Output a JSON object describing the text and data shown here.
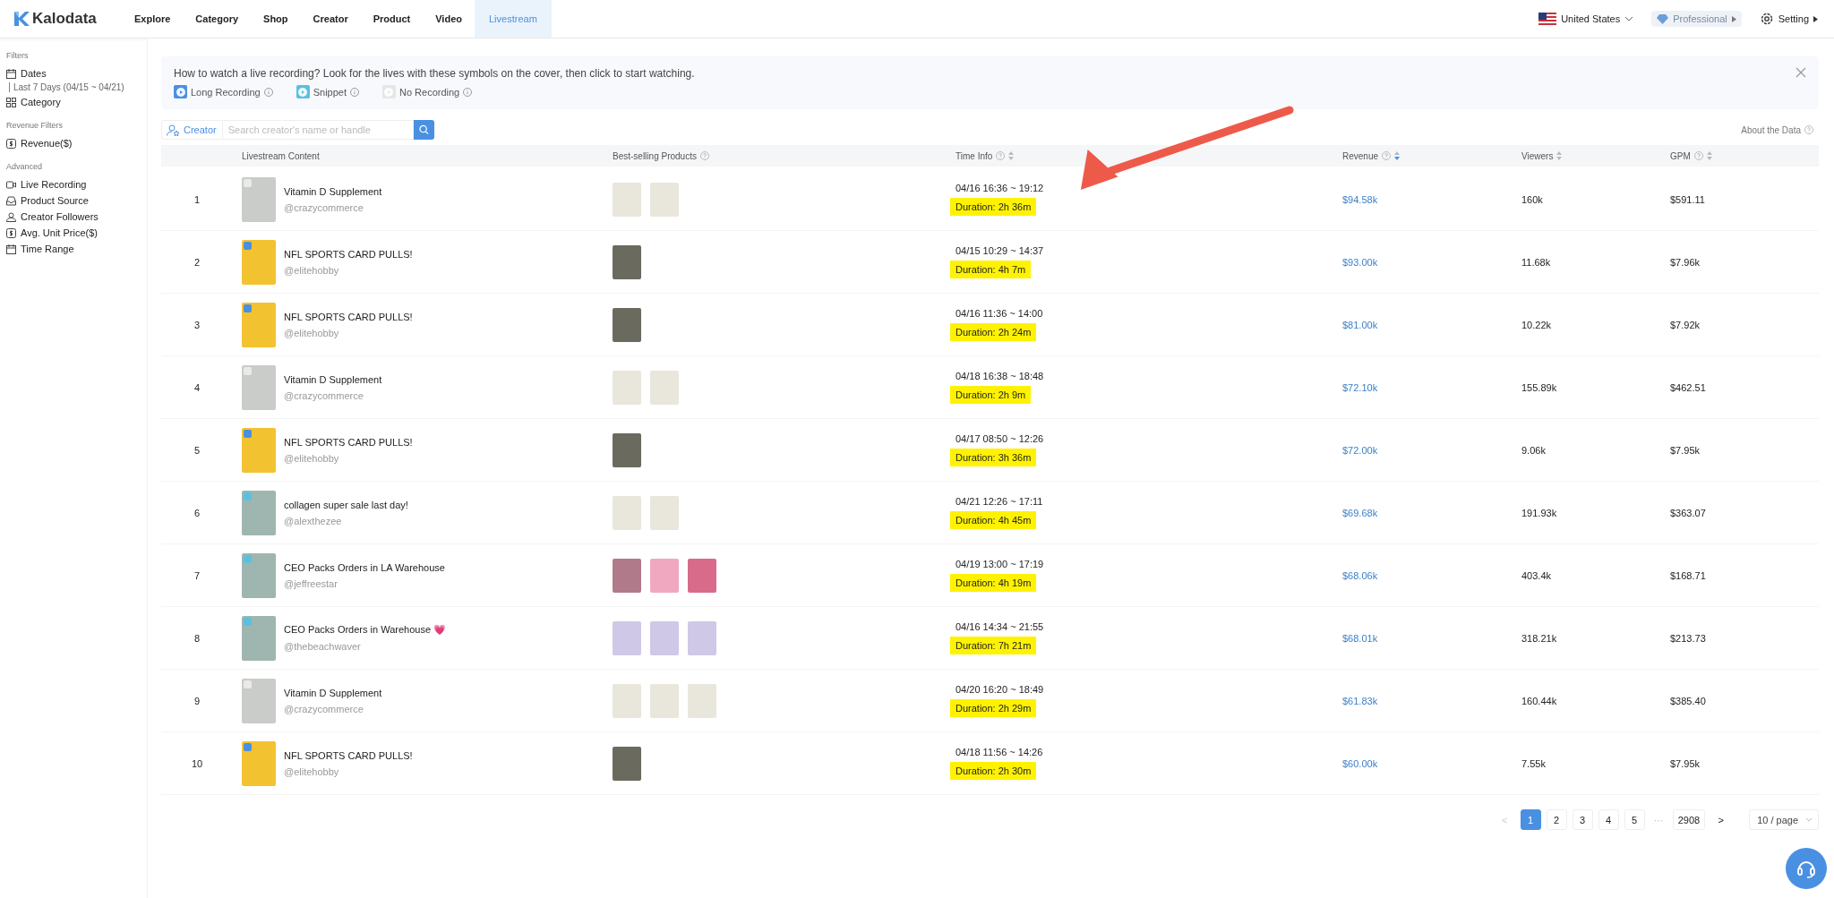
{
  "nav": {
    "logo": "Kalodata",
    "tabs": [
      {
        "label": "Explore",
        "selected": false
      },
      {
        "label": "Category",
        "selected": false
      },
      {
        "label": "Shop",
        "selected": false
      },
      {
        "label": "Creator",
        "selected": false
      },
      {
        "label": "Product",
        "selected": false
      },
      {
        "label": "Video",
        "selected": false
      },
      {
        "label": "Livestream",
        "selected": true
      }
    ],
    "region": "United States",
    "plan": "Professional",
    "settings": "Setting"
  },
  "sidebar": {
    "sections": [
      {
        "title": "Filters",
        "items": [
          {
            "label": "Dates",
            "value": "Last 7 Days (04/15 ~ 04/21)"
          },
          {
            "label": "Category"
          }
        ]
      },
      {
        "title": "Revenue Filters",
        "items": [
          {
            "label": "Revenue($)"
          }
        ]
      },
      {
        "title": "Advanced",
        "items": [
          {
            "label": "Live Recording"
          },
          {
            "label": "Product Source"
          },
          {
            "label": "Creator Followers"
          },
          {
            "label": "Avg. Unit Price($)"
          },
          {
            "label": "Time Range"
          }
        ]
      }
    ]
  },
  "banner": {
    "text": "How to watch a live recording? Look for the lives with these symbols on the cover, then click to start watching.",
    "legend": [
      {
        "label": "Long Recording",
        "kind": "long"
      },
      {
        "label": "Snippet",
        "kind": "snippet"
      },
      {
        "label": "No Recording",
        "kind": "none"
      }
    ]
  },
  "search": {
    "scope": "Creator",
    "placeholder": "Search creator's name or handle"
  },
  "about": "About the Data",
  "table": {
    "columns": [
      {
        "label": "Livestream Content",
        "info": false,
        "sortable": false,
        "sorted": false
      },
      {
        "label": "Best-selling Products",
        "info": true,
        "sortable": false,
        "sorted": false
      },
      {
        "label": "Time Info",
        "info": true,
        "sortable": true,
        "sorted": false
      },
      {
        "label": "Revenue",
        "info": true,
        "sortable": true,
        "sorted": true
      },
      {
        "label": "Viewers",
        "info": false,
        "sortable": true,
        "sorted": false
      },
      {
        "label": "GPM",
        "info": true,
        "sortable": true,
        "sorted": false
      }
    ],
    "rows": [
      {
        "rank": "1",
        "title": "Vitamin D Supplement",
        "handle": "@crazycommerce",
        "kind": "none",
        "products": [
          {
            "kind": "pouch"
          },
          {
            "kind": "pouch"
          }
        ],
        "time": "04/16 16:36 ~ 19:12",
        "duration": "Duration: 2h 36m",
        "highlighted": true,
        "revenue": "$94.58k",
        "viewers": "160k",
        "gpm": "$591.11"
      },
      {
        "rank": "2",
        "title": "NFL SPORTS CARD PULLS!",
        "handle": "@elitehobby",
        "kind": "long",
        "products": [
          {
            "kind": "box"
          }
        ],
        "time": "04/15 10:29 ~ 14:37",
        "duration": "Duration: 4h 7m",
        "highlighted": true,
        "revenue": "$93.00k",
        "viewers": "11.68k",
        "gpm": "$7.96k"
      },
      {
        "rank": "3",
        "title": "NFL SPORTS CARD PULLS!",
        "handle": "@elitehobby",
        "kind": "long",
        "products": [
          {
            "kind": "box"
          }
        ],
        "time": "04/16 11:36 ~ 14:00",
        "duration": "Duration: 2h 24m",
        "highlighted": true,
        "revenue": "$81.00k",
        "viewers": "10.22k",
        "gpm": "$7.92k"
      },
      {
        "rank": "4",
        "title": "Vitamin D Supplement",
        "handle": "@crazycommerce",
        "kind": "none",
        "products": [
          {
            "kind": "pouch"
          },
          {
            "kind": "pouch"
          }
        ],
        "time": "04/18 16:38 ~ 18:48",
        "duration": "Duration: 2h 9m",
        "highlighted": true,
        "revenue": "$72.10k",
        "viewers": "155.89k",
        "gpm": "$462.51"
      },
      {
        "rank": "5",
        "title": "NFL SPORTS CARD PULLS!",
        "handle": "@elitehobby",
        "kind": "long",
        "products": [
          {
            "kind": "box"
          }
        ],
        "time": "04/17 08:50 ~ 12:26",
        "duration": "Duration: 3h 36m",
        "highlighted": true,
        "revenue": "$72.00k",
        "viewers": "9.06k",
        "gpm": "$7.95k"
      },
      {
        "rank": "6",
        "title": "collagen super sale last day!",
        "handle": "@alexthezee",
        "kind": "snippet",
        "products": [
          {
            "kind": "pouch"
          },
          {
            "kind": "pouch"
          }
        ],
        "time": "04/21 12:26 ~ 17:11",
        "duration": "Duration: 4h 45m",
        "highlighted": true,
        "revenue": "$69.68k",
        "viewers": "191.93k",
        "gpm": "$363.07"
      },
      {
        "rank": "7",
        "title": "CEO Packs Orders in LA Warehouse",
        "handle": "@jeffreestar",
        "kind": "snippet",
        "products": [
          {
            "kind": "lipstick"
          },
          {
            "kind": "gloss"
          },
          {
            "kind": "palette"
          }
        ],
        "time": "04/19 13:00 ~ 17:19",
        "duration": "Duration: 4h 19m",
        "highlighted": true,
        "revenue": "$68.06k",
        "viewers": "403.4k",
        "gpm": "$168.71"
      },
      {
        "rank": "8",
        "title": "CEO Packs Orders in Warehouse 💗",
        "handle": "@thebeachwaver",
        "kind": "snippet",
        "products": [
          {
            "kind": "wand"
          },
          {
            "kind": "wand"
          },
          {
            "kind": "wand"
          }
        ],
        "time": "04/16 14:34 ~ 21:55",
        "duration": "Duration: 7h 21m",
        "highlighted": true,
        "revenue": "$68.01k",
        "viewers": "318.21k",
        "gpm": "$213.73"
      },
      {
        "rank": "9",
        "title": "Vitamin D Supplement",
        "handle": "@crazycommerce",
        "kind": "none",
        "products": [
          {
            "kind": "pouch"
          },
          {
            "kind": "pouch"
          },
          {
            "kind": "pouch"
          }
        ],
        "time": "04/20 16:20 ~ 18:49",
        "duration": "Duration: 2h 29m",
        "highlighted": true,
        "revenue": "$61.83k",
        "viewers": "160.44k",
        "gpm": "$385.40"
      },
      {
        "rank": "10",
        "title": "NFL SPORTS CARD PULLS!",
        "handle": "@elitehobby",
        "kind": "long",
        "products": [
          {
            "kind": "box"
          }
        ],
        "time": "04/18 11:56 ~ 14:26",
        "duration": "Duration: 2h 30m",
        "highlighted": true,
        "revenue": "$60.00k",
        "viewers": "7.55k",
        "gpm": "$7.95k"
      }
    ]
  },
  "pagination": {
    "prev": "<",
    "pages": [
      {
        "label": "1",
        "selected": true
      },
      {
        "label": "2",
        "selected": false
      },
      {
        "label": "3",
        "selected": false
      },
      {
        "label": "4",
        "selected": false
      },
      {
        "label": "5",
        "selected": false
      }
    ],
    "ellipsis": "···",
    "last": "2908",
    "next": ">",
    "page_size": "10 / page"
  }
}
